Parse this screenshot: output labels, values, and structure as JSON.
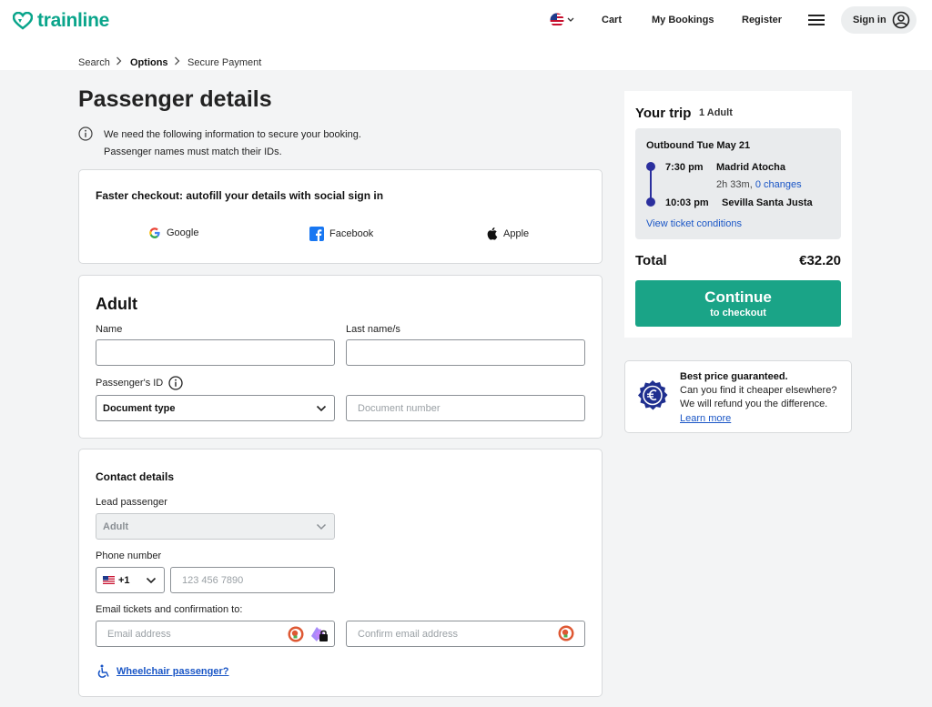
{
  "header": {
    "logo_text": "trainline",
    "nav": {
      "cart": "Cart",
      "bookings": "My Bookings",
      "register": "Register"
    },
    "signin_label": "Sign in"
  },
  "breadcrumb": {
    "step1": "Search",
    "step2": "Options",
    "step3": "Secure Payment"
  },
  "page": {
    "title": "Passenger details",
    "info_line1": "We need the following information to secure your booking.",
    "info_line2": "Passenger names must match their IDs."
  },
  "social": {
    "title": "Faster checkout: autofill your details with social sign in",
    "google": "Google",
    "facebook": "Facebook",
    "apple": "Apple"
  },
  "adult": {
    "heading": "Adult",
    "name_label": "Name",
    "name_value": "",
    "last_name_label": "Last name/s",
    "last_name_value": "",
    "id_label": "Passenger's ID",
    "doc_type_value": "Document type",
    "doc_number_placeholder": "Document number"
  },
  "contact": {
    "heading": "Contact details",
    "lead_label": "Lead passenger",
    "lead_value": "Adult",
    "phone_label": "Phone number",
    "phone_code": "+1",
    "phone_placeholder": "123 456 7890",
    "email_label": "Email tickets and confirmation to:",
    "email_placeholder": "Email address",
    "confirm_email_placeholder": "Confirm email address",
    "wheelchair_link": "Wheelchair passenger?"
  },
  "trip": {
    "title": "Your trip",
    "passengers": "1 Adult",
    "outbound": "Outbound Tue May 21",
    "depart_time": "7:30 pm",
    "depart_station": "Madrid Atocha",
    "duration": "2h 33m,",
    "changes": "0 changes",
    "arrive_time": "10:03 pm",
    "arrive_station": "Sevilla Santa Justa",
    "ticket_conditions": "View ticket conditions",
    "total_label": "Total",
    "total_value": "€32.20",
    "continue_main": "Continue",
    "continue_sub": "to checkout"
  },
  "guarantee": {
    "title": "Best price guaranteed.",
    "line1": "Can you find it cheaper elsewhere?",
    "line2": "We will refund you the difference.",
    "link": "Learn more"
  },
  "colors": {
    "brand": "#0aa58b",
    "cta": "#1aa487",
    "link": "#1a56c6",
    "route": "#2b2f9e"
  }
}
